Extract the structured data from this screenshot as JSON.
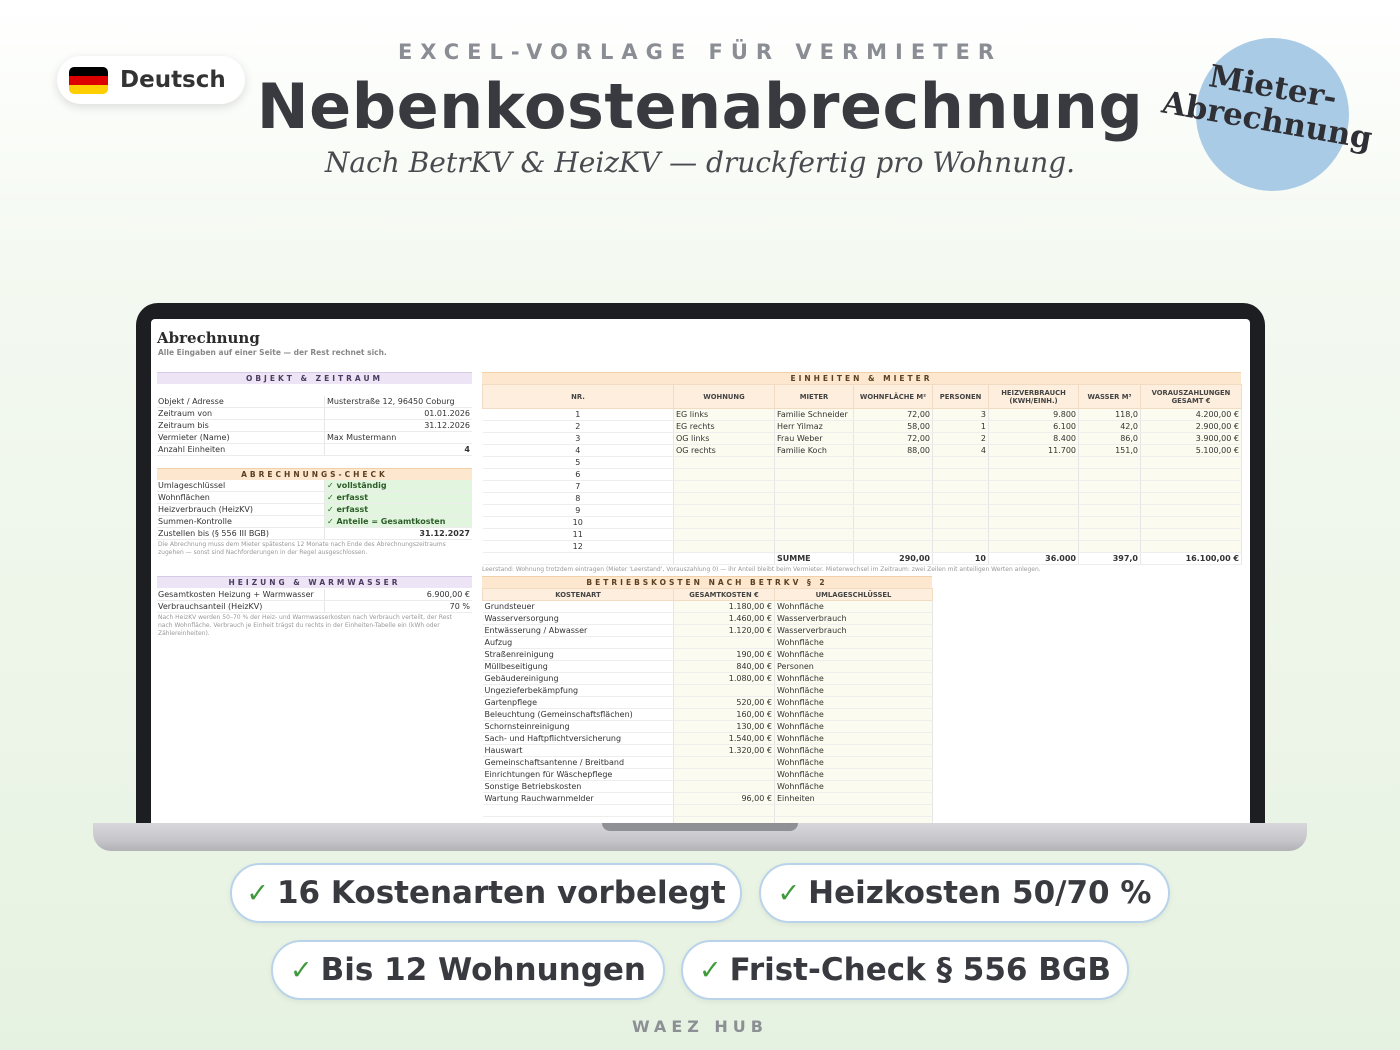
{
  "language": {
    "label": "Deutsch",
    "flag_colors": [
      "#000000",
      "#dd0000",
      "#ffce00"
    ]
  },
  "header": {
    "overline": "EXCEL-VORLAGE FÜR VERMIETER",
    "title": "Nebenkostenabrechnung",
    "subtitle": "Nach BetrKV & HeizKV — druckfertig pro Wohnung.",
    "badge_line1": "Mieter-",
    "badge_line2": "Abrechnung",
    "badge_color": "#a9cbe6"
  },
  "sheet": {
    "title": "Abrechnung",
    "subtitle": "Alle Eingaben auf einer Seite — der Rest rechnet sich.",
    "objekt": {
      "heading": "OBJEKT & ZEITRAUM",
      "rows": [
        {
          "k": "Objekt / Adresse",
          "v": "Musterstraße 12, 96450 Coburg"
        },
        {
          "k": "Zeitraum von",
          "v": "01.01.2026"
        },
        {
          "k": "Zeitraum bis",
          "v": "31.12.2026"
        },
        {
          "k": "Vermieter (Name)",
          "v": "Max Mustermann"
        },
        {
          "k": "Anzahl Einheiten",
          "v": "4"
        }
      ]
    },
    "check": {
      "heading": "ABRECHNUNGS-CHECK",
      "rows": [
        {
          "k": "Umlageschlüssel",
          "v": "✓ vollständig"
        },
        {
          "k": "Wohnflächen",
          "v": "✓ erfasst"
        },
        {
          "k": "Heizverbrauch (HeizKV)",
          "v": "✓ erfasst"
        },
        {
          "k": "Summen-Kontrolle",
          "v": "✓ Anteile = Gesamtkosten"
        },
        {
          "k": "Zustellen bis (§ 556 III BGB)",
          "v": "31.12.2027"
        }
      ],
      "note": "Die Abrechnung muss dem Mieter spätestens 12 Monate nach Ende des Abrechnungszeitraums zugehen — sonst sind Nachforderungen in der Regel ausgeschlossen."
    },
    "heizung": {
      "heading": "HEIZUNG & WARMWASSER",
      "rows": [
        {
          "k": "Gesamtkosten Heizung + Warmwasser",
          "v": "6.900,00 €"
        },
        {
          "k": "Verbrauchsanteil (HeizKV)",
          "v": "70 %"
        }
      ],
      "note": "Nach HeizKV werden 50–70 % der Heiz- und Warmwasserkosten nach Verbrauch verteilt, der Rest nach Wohnfläche. Verbrauch je Einheit trägst du rechts in der Einheiten-Tabelle ein (kWh oder Zählereinheiten)."
    },
    "units": {
      "heading": "EINHEITEN & MIETER",
      "columns": [
        "NR.",
        "WOHNUNG",
        "MIETER",
        "WOHNFLÄCHE M²",
        "PERSONEN",
        "HEIZVERBRAUCH (KWH/EINH.)",
        "WASSER M³",
        "VORAUSZAHLUNGEN GESAMT €"
      ],
      "rows": [
        [
          "1",
          "EG links",
          "Familie Schneider",
          "72,00",
          "3",
          "9.800",
          "118,0",
          "4.200,00 €"
        ],
        [
          "2",
          "EG rechts",
          "Herr Yilmaz",
          "58,00",
          "1",
          "6.100",
          "42,0",
          "2.900,00 €"
        ],
        [
          "3",
          "OG links",
          "Frau Weber",
          "72,00",
          "2",
          "8.400",
          "86,0",
          "3.900,00 €"
        ],
        [
          "4",
          "OG rechts",
          "Familie Koch",
          "88,00",
          "4",
          "11.700",
          "151,0",
          "5.100,00 €"
        ],
        [
          "5",
          "",
          "",
          "",
          "",
          "",
          "",
          ""
        ],
        [
          "6",
          "",
          "",
          "",
          "",
          "",
          "",
          ""
        ],
        [
          "7",
          "",
          "",
          "",
          "",
          "",
          "",
          ""
        ],
        [
          "8",
          "",
          "",
          "",
          "",
          "",
          "",
          ""
        ],
        [
          "9",
          "",
          "",
          "",
          "",
          "",
          "",
          ""
        ],
        [
          "10",
          "",
          "",
          "",
          "",
          "",
          "",
          ""
        ],
        [
          "11",
          "",
          "",
          "",
          "",
          "",
          "",
          ""
        ],
        [
          "12",
          "",
          "",
          "",
          "",
          "",
          "",
          ""
        ]
      ],
      "sum": [
        "",
        "",
        "SUMME",
        "290,00",
        "10",
        "36.000",
        "397,0",
        "16.100,00 €"
      ],
      "note": "Leerstand: Wohnung trotzdem eintragen (Mieter 'Leerstand', Vorauszahlung 0) — ihr Anteil bleibt beim Vermieter. Mieterwechsel im Zeitraum: zwei Zeilen mit anteiligen Werten anlegen."
    },
    "costs": {
      "heading": "BETRIEBSKOSTEN NACH BETRKV § 2",
      "columns": [
        "KOSTENART",
        "GESAMTKOSTEN €",
        "UMLAGESCHLÜSSEL"
      ],
      "rows": [
        [
          "Grundsteuer",
          "1.180,00 €",
          "Wohnfläche"
        ],
        [
          "Wasserversorgung",
          "1.460,00 €",
          "Wasserverbrauch"
        ],
        [
          "Entwässerung / Abwasser",
          "1.120,00 €",
          "Wasserverbrauch"
        ],
        [
          "Aufzug",
          "",
          "Wohnfläche"
        ],
        [
          "Straßenreinigung",
          "190,00 €",
          "Wohnfläche"
        ],
        [
          "Müllbeseitigung",
          "840,00 €",
          "Personen"
        ],
        [
          "Gebäudereinigung",
          "1.080,00 €",
          "Wohnfläche"
        ],
        [
          "Ungezieferbekämpfung",
          "",
          "Wohnfläche"
        ],
        [
          "Gartenpflege",
          "520,00 €",
          "Wohnfläche"
        ],
        [
          "Beleuchtung (Gemeinschaftsflächen)",
          "160,00 €",
          "Wohnfläche"
        ],
        [
          "Schornsteinreinigung",
          "130,00 €",
          "Wohnfläche"
        ],
        [
          "Sach- und Haftpflichtversicherung",
          "1.540,00 €",
          "Wohnfläche"
        ],
        [
          "Hauswart",
          "1.320,00 €",
          "Wohnfläche"
        ],
        [
          "Gemeinschaftsantenne / Breitband",
          "",
          "Wohnfläche"
        ],
        [
          "Einrichtungen für Wäschepflege",
          "",
          "Wohnfläche"
        ],
        [
          "Sonstige Betriebskosten",
          "",
          "Wohnfläche"
        ],
        [
          "Wartung Rauchwarnmelder",
          "96,00 €",
          "Einheiten"
        ],
        [
          "",
          "",
          ""
        ],
        [
          "",
          "",
          ""
        ]
      ]
    }
  },
  "features": [
    "16 Kostenarten vorbelegt",
    "Heizkosten 50/70 %",
    "Bis 12 Wohnungen",
    "Frist-Check § 556 BGB"
  ],
  "check_glyph": "✓",
  "brand": "WAEZ HUB"
}
